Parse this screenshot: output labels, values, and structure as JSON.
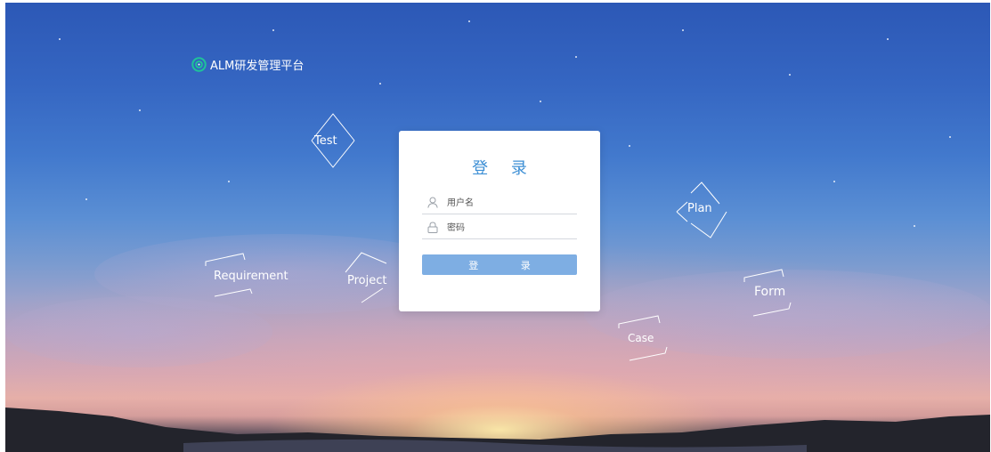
{
  "logo": {
    "text": "ALM研发管理平台",
    "icon": "app-logo-icon",
    "icon_color": "#1fc29a"
  },
  "tags": [
    "Test",
    "Requirement",
    "Project",
    "Plan",
    "Form",
    "Case"
  ],
  "login": {
    "title": "登 录",
    "username_placeholder": "用户名",
    "password_placeholder": "密码",
    "submit_label": "登 录",
    "accent_color": "#3d8fd5",
    "button_color": "#7eaee3"
  }
}
